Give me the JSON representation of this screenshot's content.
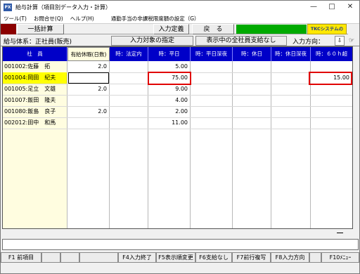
{
  "window": {
    "icon_label": "PX",
    "title": "給与計算（項目別データ入力・計算）",
    "minimize": "—",
    "maximize": "□",
    "close": "✕"
  },
  "menu": {
    "items": [
      "ツール(T)",
      "お問合せ(Q)",
      "ヘルプ(H)",
      "通勤手当の非課税限度額の設定（G）"
    ]
  },
  "toolbar": {
    "bulk_calc": "一括計算",
    "input_def": "入力定義",
    "back": "戻　る",
    "logo_text": "TKCシステムのLG6.A"
  },
  "info": {
    "salary_system": "給与体系：正社員(販売)",
    "input_target": "入力対象の指定",
    "pay_all": "表示中の全社員支給なし",
    "input_dir_label": "入力方向：",
    "dir_icon": "⇩",
    "hand_icon": "☞"
  },
  "grid": {
    "headers": [
      "社　員",
      "有給休暇(日数)",
      "時：法定内",
      "時：平日",
      "時：平日深夜",
      "時：休日",
      "時：休日深夜",
      "時：６０ｈ超"
    ],
    "rows": [
      {
        "name": "001002:佐藤　拓",
        "paid": "2.0",
        "legal": "",
        "weekday": "5.00",
        "wnight": "",
        "holiday": "",
        "hnight": "",
        "over60": ""
      },
      {
        "name": "001004:岡田　紀夫",
        "paid": "",
        "legal": "",
        "weekday": "75.00",
        "wnight": "",
        "holiday": "",
        "hnight": "",
        "over60": "15.00"
      },
      {
        "name": "001005:足立　文雄",
        "paid": "2.0",
        "legal": "",
        "weekday": "9.00",
        "wnight": "",
        "holiday": "",
        "hnight": "",
        "over60": ""
      },
      {
        "name": "001007:飯田　隆夫",
        "paid": "",
        "legal": "",
        "weekday": "4.00",
        "wnight": "",
        "holiday": "",
        "hnight": "",
        "over60": ""
      },
      {
        "name": "001080:飯島　良子",
        "paid": "2.0",
        "legal": "",
        "weekday": "2.00",
        "wnight": "",
        "holiday": "",
        "hnight": "",
        "over60": ""
      },
      {
        "name": "002012:田中　和馬",
        "paid": "",
        "legal": "",
        "weekday": "11.00",
        "wnight": "",
        "holiday": "",
        "hnight": "",
        "over60": ""
      }
    ]
  },
  "fkeys": [
    "F1 前項目",
    "",
    "",
    "",
    "F4入力終了",
    "F5表示順変更",
    "F6支給なし",
    "F7前行複写",
    "F8入力方向",
    "",
    "F10ﾒﾆｭｰ"
  ],
  "colors": {
    "header_blue": "#0000c8",
    "highlight_red": "#e00000",
    "selected_yellow": "#ffff00"
  }
}
